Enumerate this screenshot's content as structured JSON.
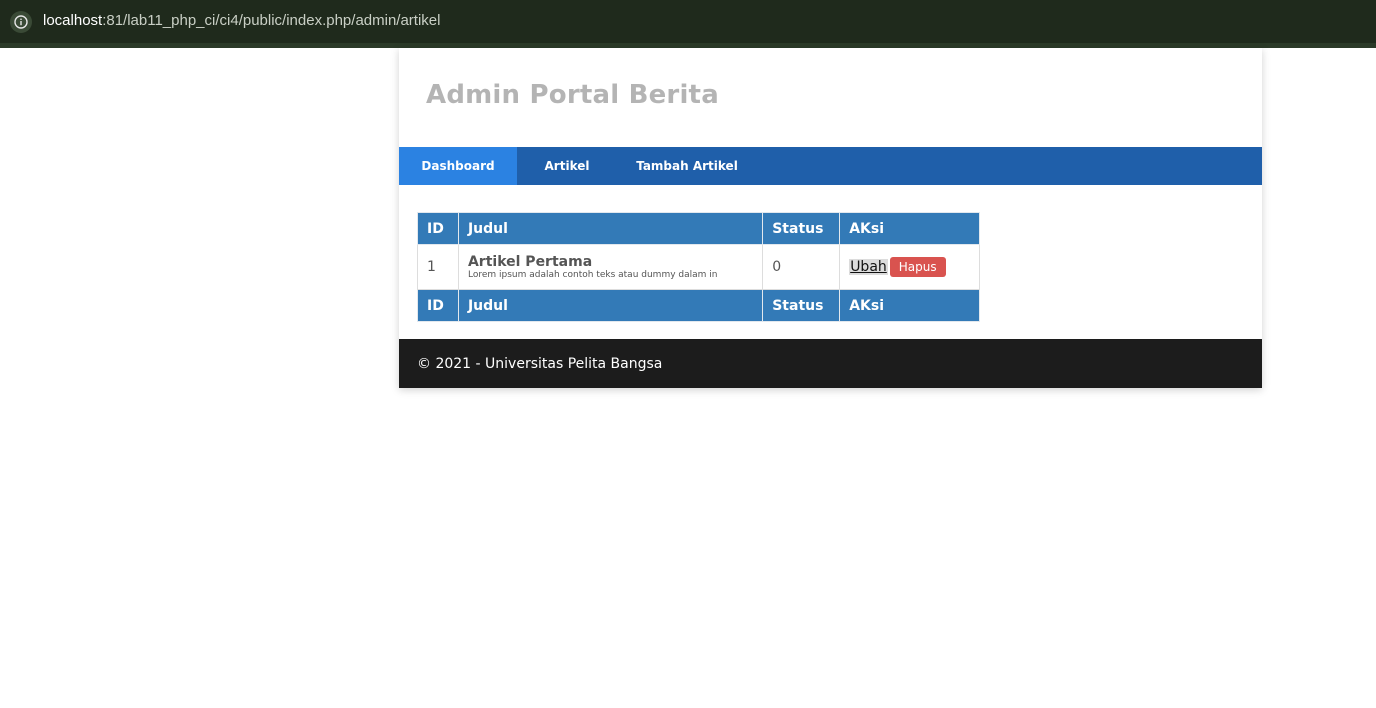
{
  "browser": {
    "url_host": "localhost",
    "url_rest": ":81/lab11_php_ci/ci4/public/index.php/admin/artikel",
    "info_icon": "info-icon"
  },
  "header": {
    "title": "Admin Portal Berita"
  },
  "nav": {
    "items": [
      {
        "label": "Dashboard",
        "active": true
      },
      {
        "label": "Artikel",
        "active": false
      },
      {
        "label": "Tambah Artikel",
        "active": false
      }
    ]
  },
  "table": {
    "headers": [
      "ID",
      "Judul",
      "Status",
      "AKsi"
    ],
    "rows": [
      {
        "id": "1",
        "title": "Artikel Pertama",
        "excerpt": "Lorem ipsum adalah contoh teks atau dummy dalam in",
        "status": "0",
        "edit_label": "Ubah",
        "delete_label": "Hapus"
      }
    ],
    "footer_headers": [
      "ID",
      "Judul",
      "Status",
      "AKsi"
    ]
  },
  "footer": {
    "text": "© 2021 - Universitas Pelita Bangsa"
  },
  "colors": {
    "nav_bg": "#1f5faa",
    "nav_active": "#2b82e2",
    "table_header": "#337ab7",
    "delete_button": "#d9534f",
    "footer_bg": "#1c1c1c"
  }
}
